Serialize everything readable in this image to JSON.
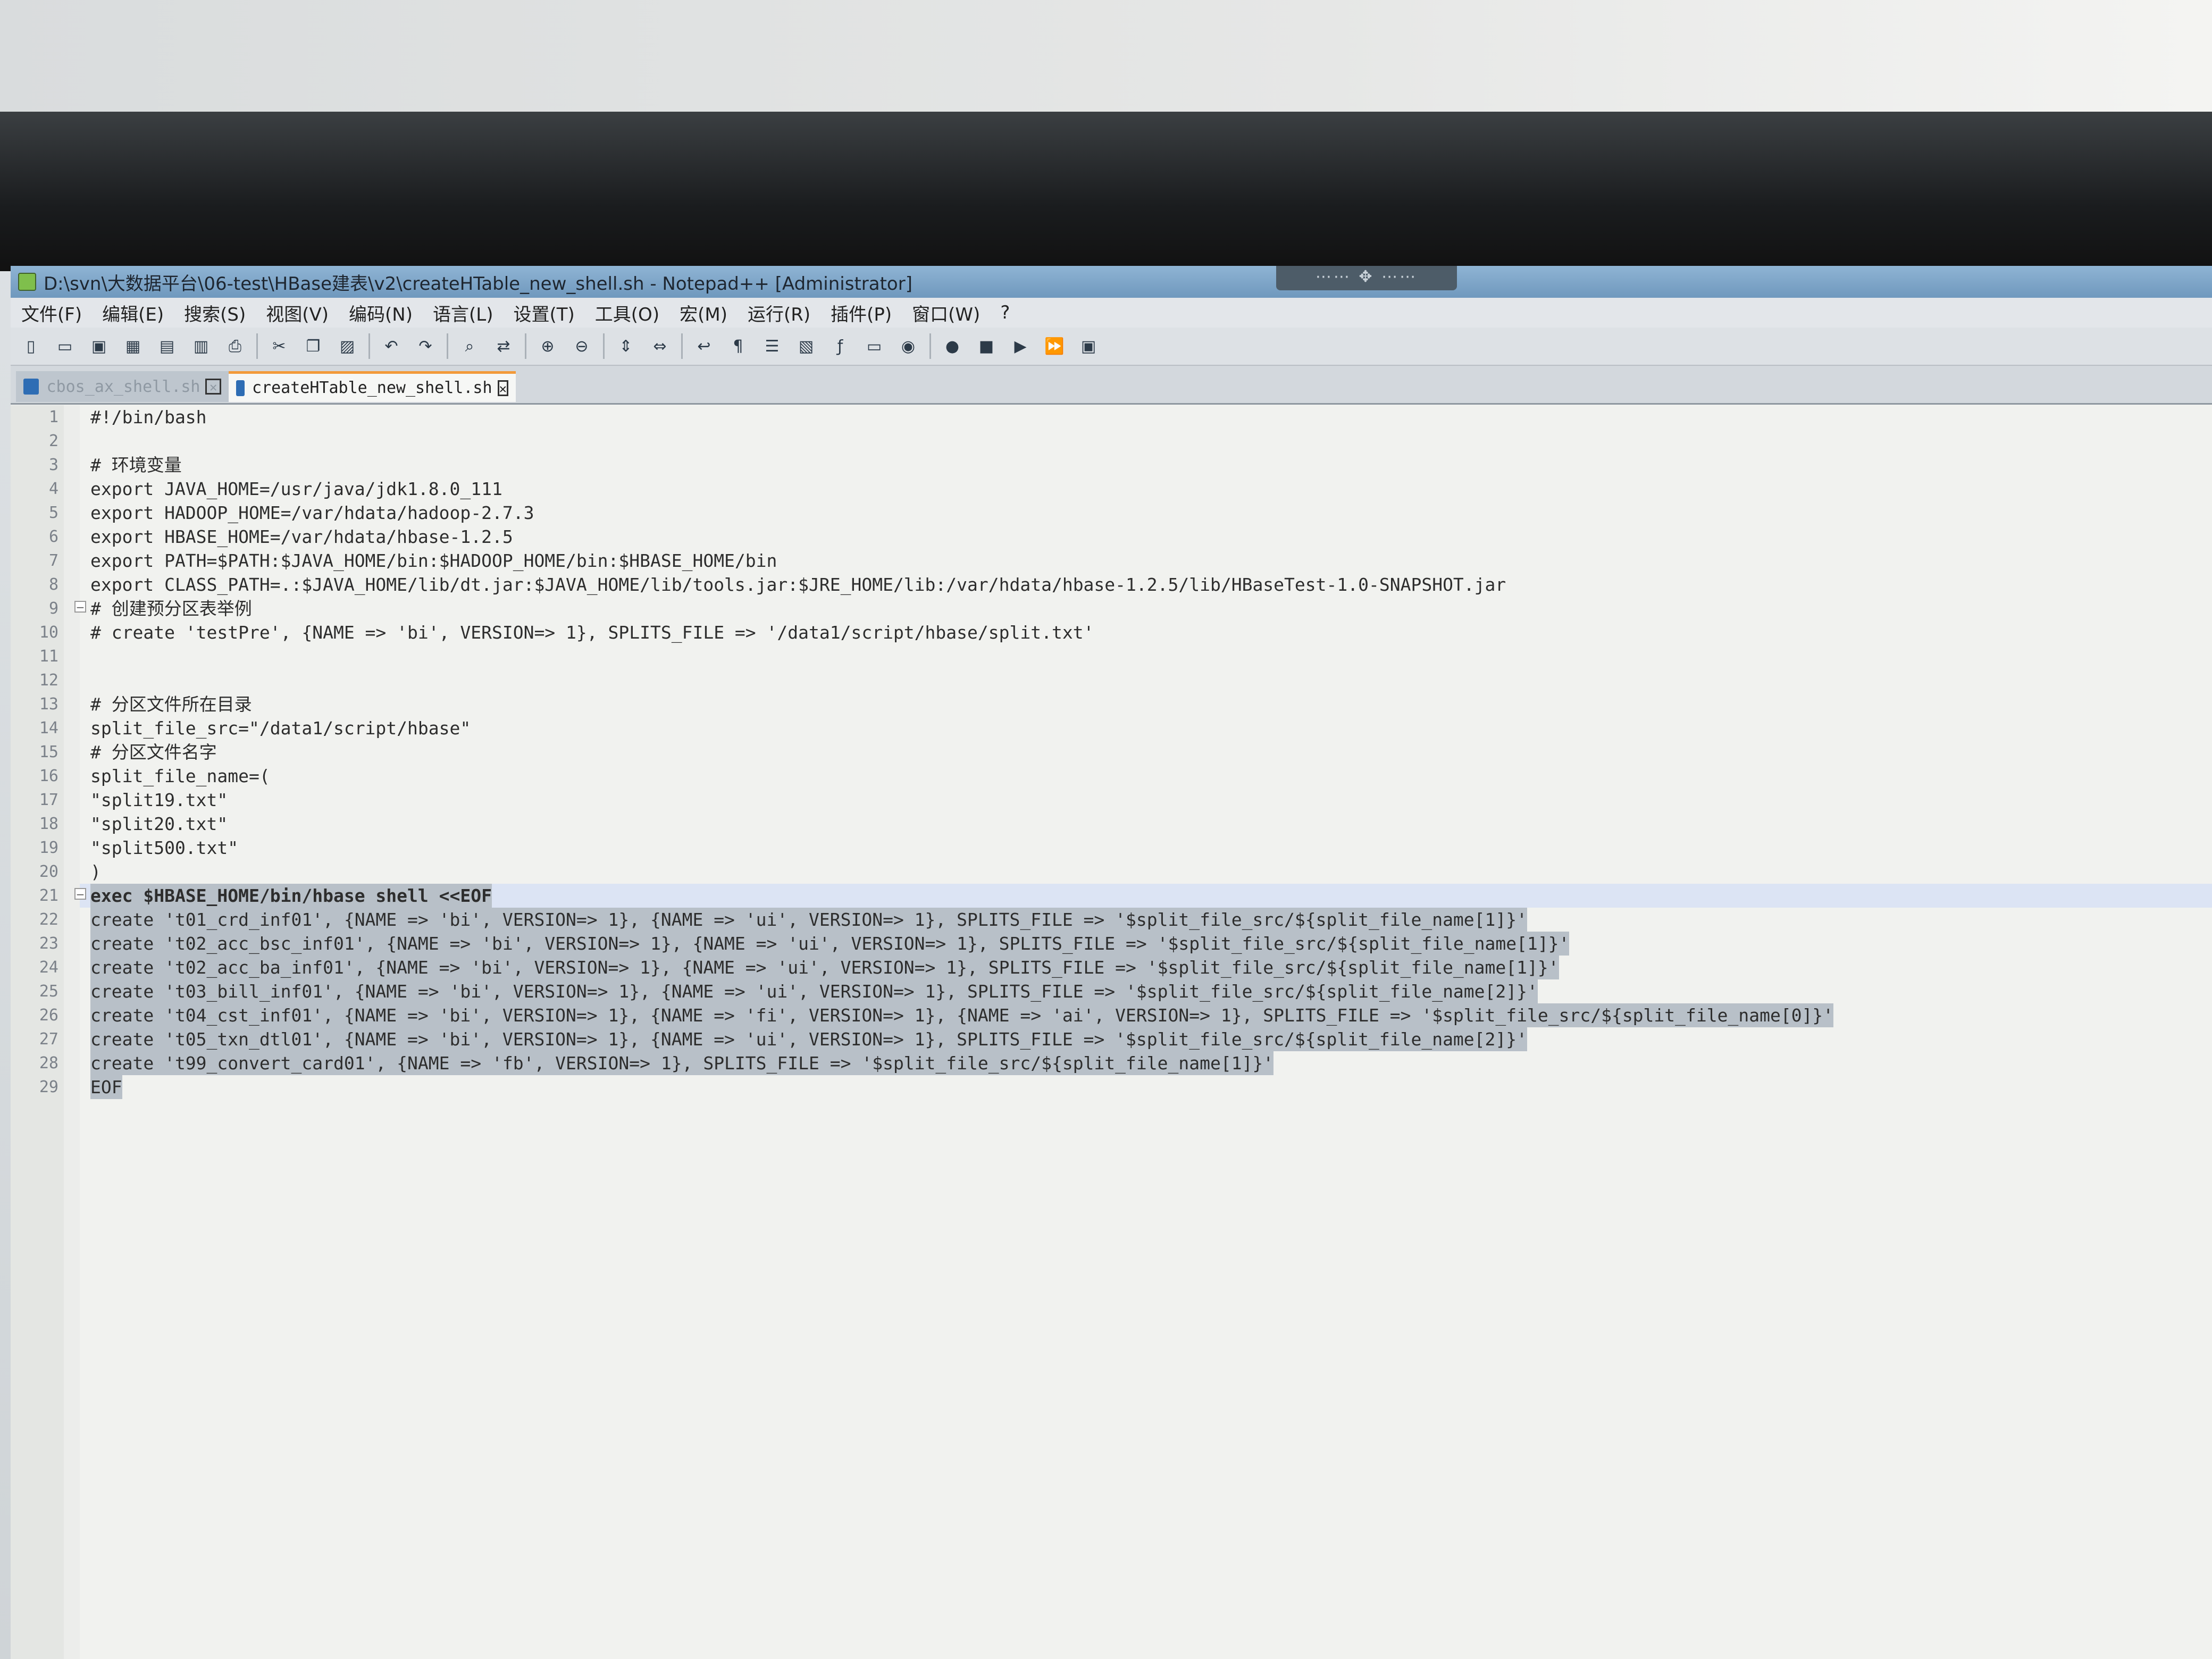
{
  "window": {
    "title": "D:\\svn\\大数据平台\\06-test\\HBase建表\\v2\\createHTable_new_shell.sh - Notepad++ [Administrator]"
  },
  "menu": [
    "文件(F)",
    "编辑(E)",
    "搜索(S)",
    "视图(V)",
    "编码(N)",
    "语言(L)",
    "设置(T)",
    "工具(O)",
    "宏(M)",
    "运行(R)",
    "插件(P)",
    "窗口(W)",
    "?"
  ],
  "tabs": [
    {
      "label": "cbos_ax_shell.sh",
      "active": false
    },
    {
      "label": "createHTable_new_shell.sh",
      "active": true
    }
  ],
  "toolbar_icons": [
    "new-file-icon",
    "open-file-icon",
    "save-icon",
    "save-all-icon",
    "close-icon",
    "close-all-icon",
    "print-icon",
    "cut-icon",
    "copy-icon",
    "paste-icon",
    "undo-icon",
    "redo-icon",
    "find-icon",
    "replace-icon",
    "zoom-in-icon",
    "zoom-out-icon",
    "sync-v-icon",
    "sync-h-icon",
    "word-wrap-icon",
    "show-all-chars-icon",
    "indent-guide-icon",
    "doc-map-icon",
    "function-list-icon",
    "folder-workspace-icon",
    "monitor-icon",
    "record-macro-icon",
    "stop-macro-icon",
    "play-macro-icon",
    "run-macro-multiple-icon",
    "save-macro-icon"
  ],
  "code_lines": [
    {
      "n": "1",
      "text": "#!/bin/bash"
    },
    {
      "n": "2",
      "text": ""
    },
    {
      "n": "3",
      "text": "# 环境变量"
    },
    {
      "n": "4",
      "text": "export JAVA_HOME=/usr/java/jdk1.8.0_111"
    },
    {
      "n": "5",
      "text": "export HADOOP_HOME=/var/hdata/hadoop-2.7.3"
    },
    {
      "n": "6",
      "text": "export HBASE_HOME=/var/hdata/hbase-1.2.5"
    },
    {
      "n": "7",
      "text": "export PATH=$PATH:$JAVA_HOME/bin:$HADOOP_HOME/bin:$HBASE_HOME/bin"
    },
    {
      "n": "8",
      "text": "export CLASS_PATH=.:$JAVA_HOME/lib/dt.jar:$JAVA_HOME/lib/tools.jar:$JRE_HOME/lib:/var/hdata/hbase-1.2.5/lib/HBaseTest-1.0-SNAPSHOT.jar"
    },
    {
      "n": "9",
      "text": "# 创建预分区表举例"
    },
    {
      "n": "10",
      "text": "# create 'testPre', {NAME => 'bi', VERSION=> 1}, SPLITS_FILE => '/data1/script/hbase/split.txt'"
    },
    {
      "n": "11",
      "text": ""
    },
    {
      "n": "12",
      "text": ""
    },
    {
      "n": "13",
      "text": "# 分区文件所在目录"
    },
    {
      "n": "14",
      "text": "split_file_src=\"/data1/script/hbase\""
    },
    {
      "n": "15",
      "text": "# 分区文件名字"
    },
    {
      "n": "16",
      "text": "split_file_name=("
    },
    {
      "n": "17",
      "text": "\"split19.txt\""
    },
    {
      "n": "18",
      "text": "\"split20.txt\""
    },
    {
      "n": "19",
      "text": "\"split500.txt\""
    },
    {
      "n": "20",
      "text": ")"
    },
    {
      "n": "21",
      "text": "exec $HBASE_HOME/bin/hbase shell <<EOF"
    },
    {
      "n": "22",
      "text": "create 't01_crd_inf01', {NAME => 'bi', VERSION=> 1}, {NAME => 'ui', VERSION=> 1}, SPLITS_FILE => '$split_file_src/${split_file_name[1]}'"
    },
    {
      "n": "23",
      "text": "create 't02_acc_bsc_inf01', {NAME => 'bi', VERSION=> 1}, {NAME => 'ui', VERSION=> 1}, SPLITS_FILE => '$split_file_src/${split_file_name[1]}'"
    },
    {
      "n": "24",
      "text": "create 't02_acc_ba_inf01', {NAME => 'bi', VERSION=> 1}, {NAME => 'ui', VERSION=> 1}, SPLITS_FILE => '$split_file_src/${split_file_name[1]}'"
    },
    {
      "n": "25",
      "text": "create 't03_bill_inf01', {NAME => 'bi', VERSION=> 1}, {NAME => 'ui', VERSION=> 1}, SPLITS_FILE => '$split_file_src/${split_file_name[2]}'"
    },
    {
      "n": "26",
      "text": "create 't04_cst_inf01', {NAME => 'bi', VERSION=> 1}, {NAME => 'fi', VERSION=> 1}, {NAME => 'ai', VERSION=> 1}, SPLITS_FILE => '$split_file_src/${split_file_name[0]}'"
    },
    {
      "n": "27",
      "text": "create 't05_txn_dtl01', {NAME => 'bi', VERSION=> 1}, {NAME => 'ui', VERSION=> 1}, SPLITS_FILE => '$split_file_src/${split_file_name[2]}'"
    },
    {
      "n": "28",
      "text": "create 't99_convert_card01', {NAME => 'fb', VERSION=> 1}, SPLITS_FILE => '$split_file_src/${split_file_name[1]}'"
    },
    {
      "n": "29",
      "text": "EOF"
    }
  ],
  "colors": {
    "comment": "#3d8f3d",
    "keyword": "#1a1ad6",
    "variable": "#e08a00",
    "heredoc_body": "#cf2b2b",
    "selection": "#b8c0c8",
    "tab_accent": "#f29a3a"
  }
}
